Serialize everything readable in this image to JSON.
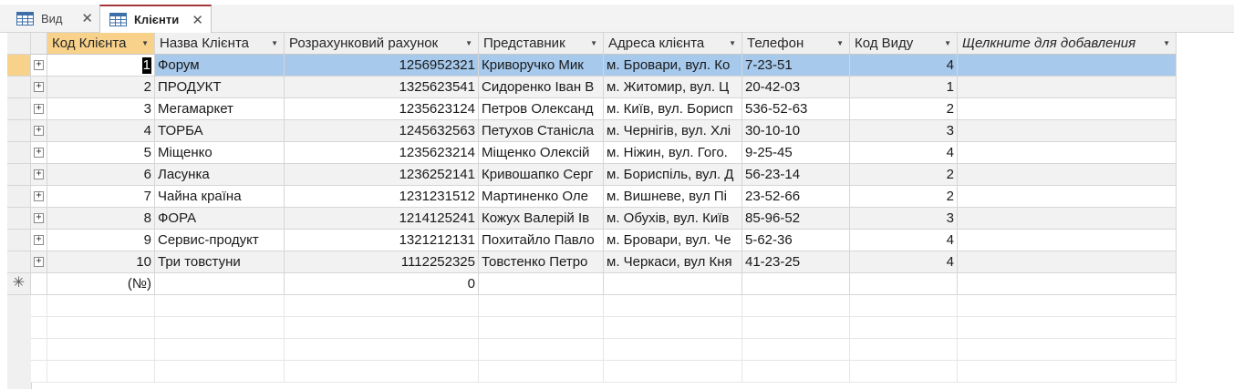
{
  "tabs": [
    {
      "label": "Вид",
      "active": false
    },
    {
      "label": "Клієнти",
      "active": true
    }
  ],
  "columns": [
    "Код Клієнта",
    "Назва Клієнта",
    "Розрахунковий рахунок",
    "Представник",
    "Адреса клієнта",
    "Телефон",
    "Код Виду",
    "Щелкните для добавления"
  ],
  "rows": [
    [
      "1",
      "Форум",
      "1256952321",
      "Криворучко Мик",
      "м. Бровари, вул. Ко",
      "7-23-51",
      "4"
    ],
    [
      "2",
      "ПРОДУКТ",
      "1325623541",
      "Сидоренко Іван В",
      "м. Житомир, вул. Ц",
      "20-42-03",
      "1"
    ],
    [
      "3",
      "Мегамаркет",
      "1235623124",
      "Петров Олександ",
      "м. Київ, вул. Борисп",
      "536-52-63",
      "2"
    ],
    [
      "4",
      "ТОРБА",
      "1245632563",
      "Петухов Станісла",
      "м. Чернігів, вул. Хлі",
      "30-10-10",
      "3"
    ],
    [
      "5",
      "Міщенко",
      "1235623214",
      "Міщенко Олексій",
      "м. Ніжин, вул. Гого.",
      "9-25-45",
      "4"
    ],
    [
      "6",
      "Ласунка",
      "1236252141",
      "Кривошапко Серг",
      "м. Бориспіль, вул. Д",
      "56-23-14",
      "2"
    ],
    [
      "7",
      "Чайна країна",
      "1231231512",
      "Мартиненко Оле",
      "м. Вишневе, вул Пі",
      "23-52-66",
      "2"
    ],
    [
      "8",
      "ФОРА",
      "1214125241",
      "Кожух Валерій Ів",
      "м. Обухів, вул. Київ",
      "85-96-52",
      "3"
    ],
    [
      "9",
      "Сервис-продукт",
      "1321212131",
      "Похитайло Павло",
      "м. Бровари, вул. Че",
      "5-62-36",
      "4"
    ],
    [
      "10",
      "Три товстуни",
      "1112252325",
      "Товстенко Петро",
      "м. Черкаси, вул Кня",
      "41-23-25",
      "4"
    ]
  ],
  "new_row": {
    "id_placeholder": "(№)",
    "account_default": "0",
    "marker": "✳"
  },
  "colors": {
    "active_tab_accent": "#a4373a",
    "selected_row": "#a6c9ec",
    "active_header": "#f8d28a"
  }
}
